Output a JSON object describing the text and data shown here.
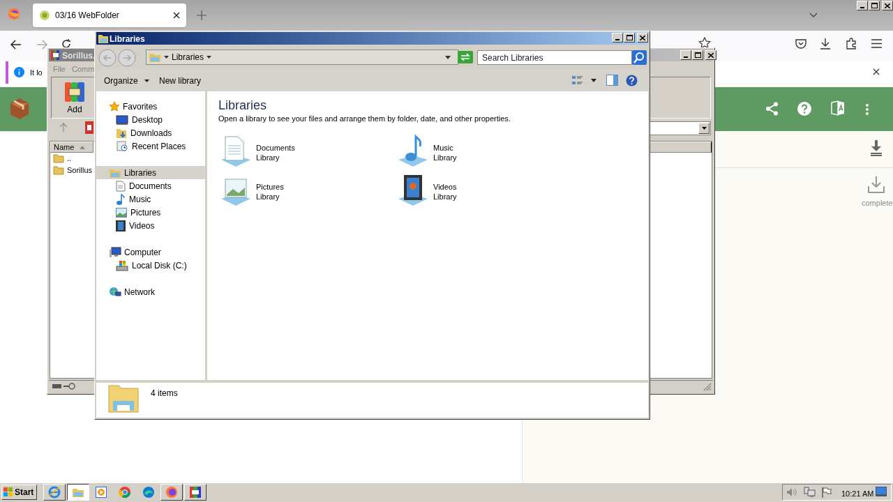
{
  "browser": {
    "tabs": [
      {
        "title": "03/16 WebFolder",
        "selected": true
      }
    ],
    "notification": "It lo",
    "download_panel": {
      "status": "complete"
    }
  },
  "winrar": {
    "title": "Sorillus.",
    "menu": [
      "File",
      "Comm"
    ],
    "toolbar": [
      "Add"
    ],
    "columns": [
      "Name"
    ],
    "rows": [
      "..",
      "Sorillus"
    ]
  },
  "explorer": {
    "title": "Libraries",
    "address": "Libraries",
    "search": {
      "placeholder": "Search Libraries"
    },
    "toolbar": [
      "Organize",
      "New library"
    ],
    "nav": [
      {
        "label": "Favorites",
        "selected": false,
        "children": [
          {
            "label": "Desktop"
          },
          {
            "label": "Downloads"
          },
          {
            "label": "Recent Places"
          }
        ]
      },
      {
        "label": "Libraries",
        "selected": true,
        "children": [
          {
            "label": "Documents"
          },
          {
            "label": "Music"
          },
          {
            "label": "Pictures"
          },
          {
            "label": "Videos"
          }
        ]
      },
      {
        "label": "Computer",
        "selected": false,
        "children": [
          {
            "label": "Local Disk (C:)"
          }
        ]
      },
      {
        "label": "Network",
        "selected": false
      }
    ],
    "heading": "Libraries",
    "description": "Open a library to see your files and arrange them by folder, date, and other properties.",
    "libraries": [
      {
        "name": "Documents",
        "type": "Library"
      },
      {
        "name": "Music",
        "type": "Library"
      },
      {
        "name": "Pictures",
        "type": "Library"
      },
      {
        "name": "Videos",
        "type": "Library"
      }
    ],
    "status": "4 items"
  },
  "taskbar": {
    "start": "Start",
    "items": [
      {
        "open": true,
        "selected": false
      },
      {
        "open": true,
        "selected": true
      },
      {
        "open": false,
        "selected": false
      },
      {
        "open": false,
        "selected": false
      },
      {
        "open": false,
        "selected": false
      },
      {
        "open": true,
        "selected": false
      },
      {
        "open": true,
        "selected": false
      }
    ],
    "clock": "10:21 AM"
  }
}
